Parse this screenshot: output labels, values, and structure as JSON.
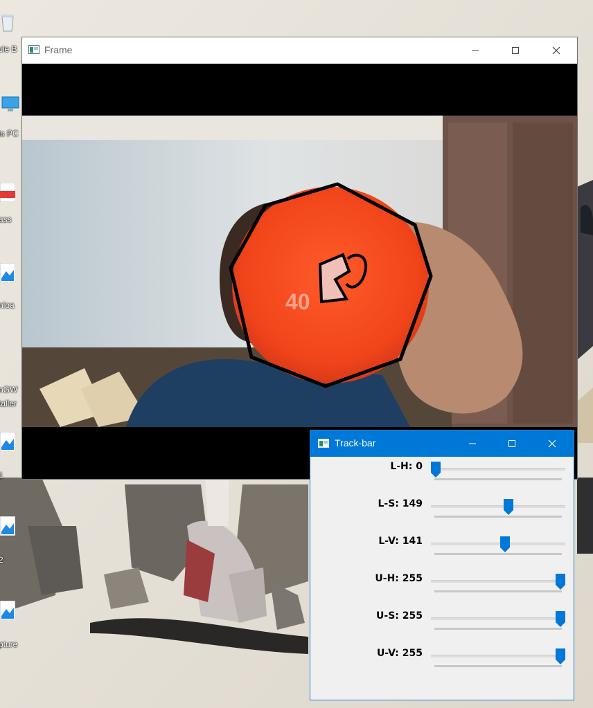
{
  "desktop": {
    "icons": [
      {
        "name": "recycle-bin",
        "label": "cle B"
      },
      {
        "name": "this-pc",
        "label": "is PC"
      },
      {
        "name": "pdf-file",
        "label": "ass"
      },
      {
        "name": "download",
        "label": "nloa"
      },
      {
        "name": "mingw-installer",
        "label": "nGW"
      },
      {
        "name": "installer-2",
        "label": "taller"
      },
      {
        "name": "image-1",
        "label": "1"
      },
      {
        "name": "image-2",
        "label": "2"
      },
      {
        "name": "capture",
        "label": "pture"
      }
    ]
  },
  "frame_window": {
    "title": "Frame",
    "icon": "opencv-window-icon",
    "controls": {
      "minimize": "minimize-icon",
      "maximize": "maximize-icon",
      "close": "close-icon"
    },
    "detection": {
      "label": "40",
      "shape": "octagon",
      "outline_color": "#000000",
      "object_color": "#f04a1c"
    }
  },
  "trackbar_window": {
    "title": "Track-bar",
    "icon": "opencv-window-icon",
    "accent": "#0078d7",
    "max": 255,
    "sliders": [
      {
        "key": "L-H",
        "label": "L-H: 0",
        "value": 0
      },
      {
        "key": "L-S",
        "label": "L-S: 149",
        "value": 149
      },
      {
        "key": "L-V",
        "label": "L-V: 141",
        "value": 141
      },
      {
        "key": "U-H",
        "label": "U-H: 255",
        "value": 255
      },
      {
        "key": "U-S",
        "label": "U-S: 255",
        "value": 255
      },
      {
        "key": "U-V",
        "label": "U-V: 255",
        "value": 255
      }
    ]
  }
}
